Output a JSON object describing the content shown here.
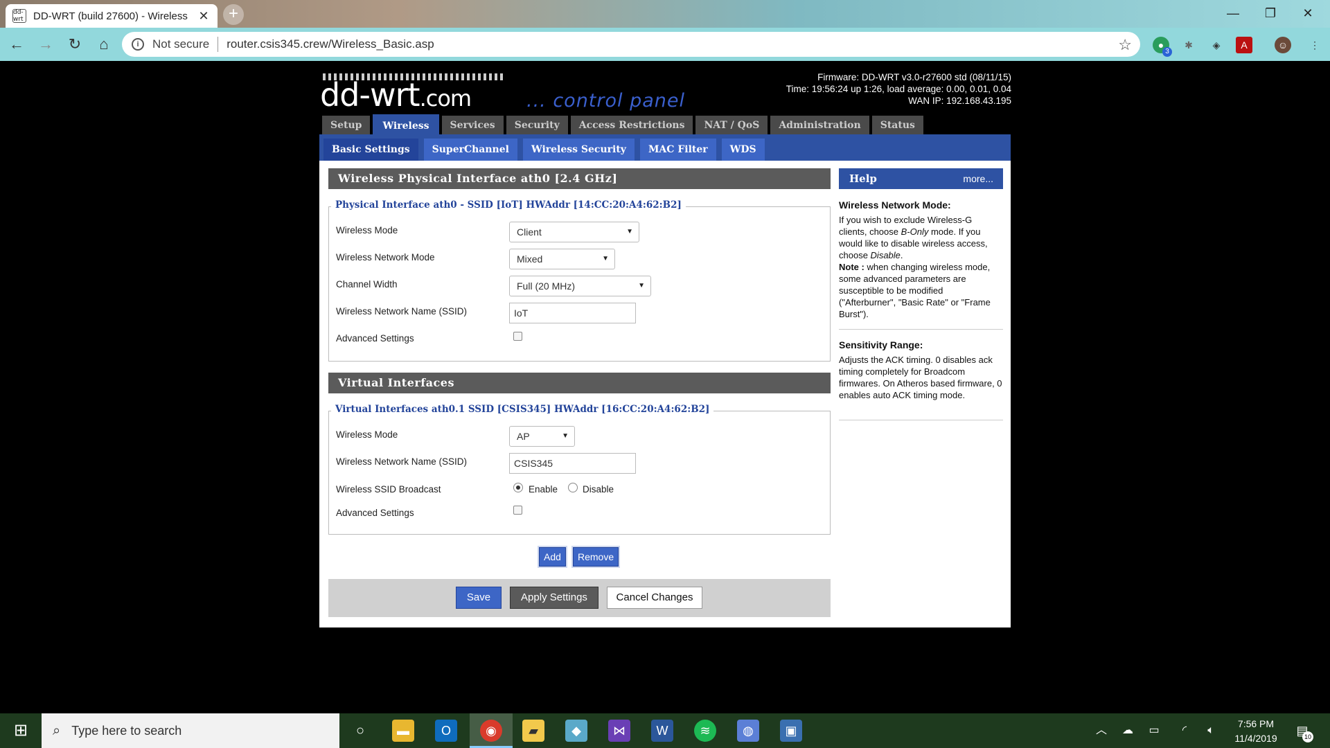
{
  "browser": {
    "tab_title": "DD-WRT (build 27600) - Wireless",
    "tab_favicon_text": "dd-wrt",
    "not_secure": "Not secure",
    "url": "router.csis345.crew/Wireless_Basic.asp",
    "extension_badge": "3"
  },
  "header": {
    "logo": "dd-wrt",
    "logo_suffix": ".com",
    "tagline": "... control panel",
    "firmware": "Firmware: DD-WRT v3.0-r27600 std (08/11/15)",
    "time": "Time: 19:56:24 up 1:26, load average: 0.00, 0.01, 0.04",
    "wan_ip": "WAN IP: 192.168.43.195"
  },
  "main_tabs": [
    "Setup",
    "Wireless",
    "Services",
    "Security",
    "Access Restrictions",
    "NAT / QoS",
    "Administration",
    "Status"
  ],
  "sub_tabs": [
    "Basic Settings",
    "SuperChannel",
    "Wireless Security",
    "MAC Filter",
    "WDS"
  ],
  "physical": {
    "title": "Wireless Physical Interface ath0 [2.4 GHz]",
    "legend": "Physical Interface ath0 - SSID [IoT] HWAddr [14:CC:20:A4:62:B2]",
    "wireless_mode_label": "Wireless Mode",
    "wireless_mode_value": "Client",
    "network_mode_label": "Wireless Network Mode",
    "network_mode_value": "Mixed",
    "channel_width_label": "Channel Width",
    "channel_width_value": "Full (20 MHz)",
    "ssid_label": "Wireless Network Name (SSID)",
    "ssid_value": "IoT",
    "advanced_label": "Advanced Settings"
  },
  "virtual": {
    "title": "Virtual Interfaces",
    "legend": "Virtual Interfaces ath0.1 SSID [CSIS345] HWAddr [16:CC:20:A4:62:B2]",
    "wireless_mode_label": "Wireless Mode",
    "wireless_mode_value": "AP",
    "ssid_label": "Wireless Network Name (SSID)",
    "ssid_value": "CSIS345",
    "broadcast_label": "Wireless SSID Broadcast",
    "enable_label": "Enable",
    "disable_label": "Disable",
    "advanced_label": "Advanced Settings",
    "add_label": "Add",
    "remove_label": "Remove"
  },
  "buttons": {
    "save": "Save",
    "apply": "Apply Settings",
    "cancel": "Cancel Changes"
  },
  "help": {
    "title": "Help",
    "more": "more...",
    "h1": "Wireless Network Mode:",
    "p1a": "If you wish to exclude Wireless-G clients, choose ",
    "p1b": "B-Only",
    "p1c": " mode. If you would like to disable wireless access, choose ",
    "p1d": "Disable",
    "p1e": ".",
    "note_label": "Note :",
    "note_text": " when changing wireless mode, some advanced parameters are susceptible to be modified (\"Afterburner\", \"Basic Rate\" or \"Frame Burst\").",
    "h2": "Sensitivity Range:",
    "p2": "Adjusts the ACK timing. 0 disables ack timing completely for Broadcom firmwares. On Atheros based firmware, 0 enables auto ACK timing mode."
  },
  "taskbar": {
    "search_placeholder": "Type here to search",
    "time": "7:56 PM",
    "date": "11/4/2019",
    "notification_count": "10"
  }
}
